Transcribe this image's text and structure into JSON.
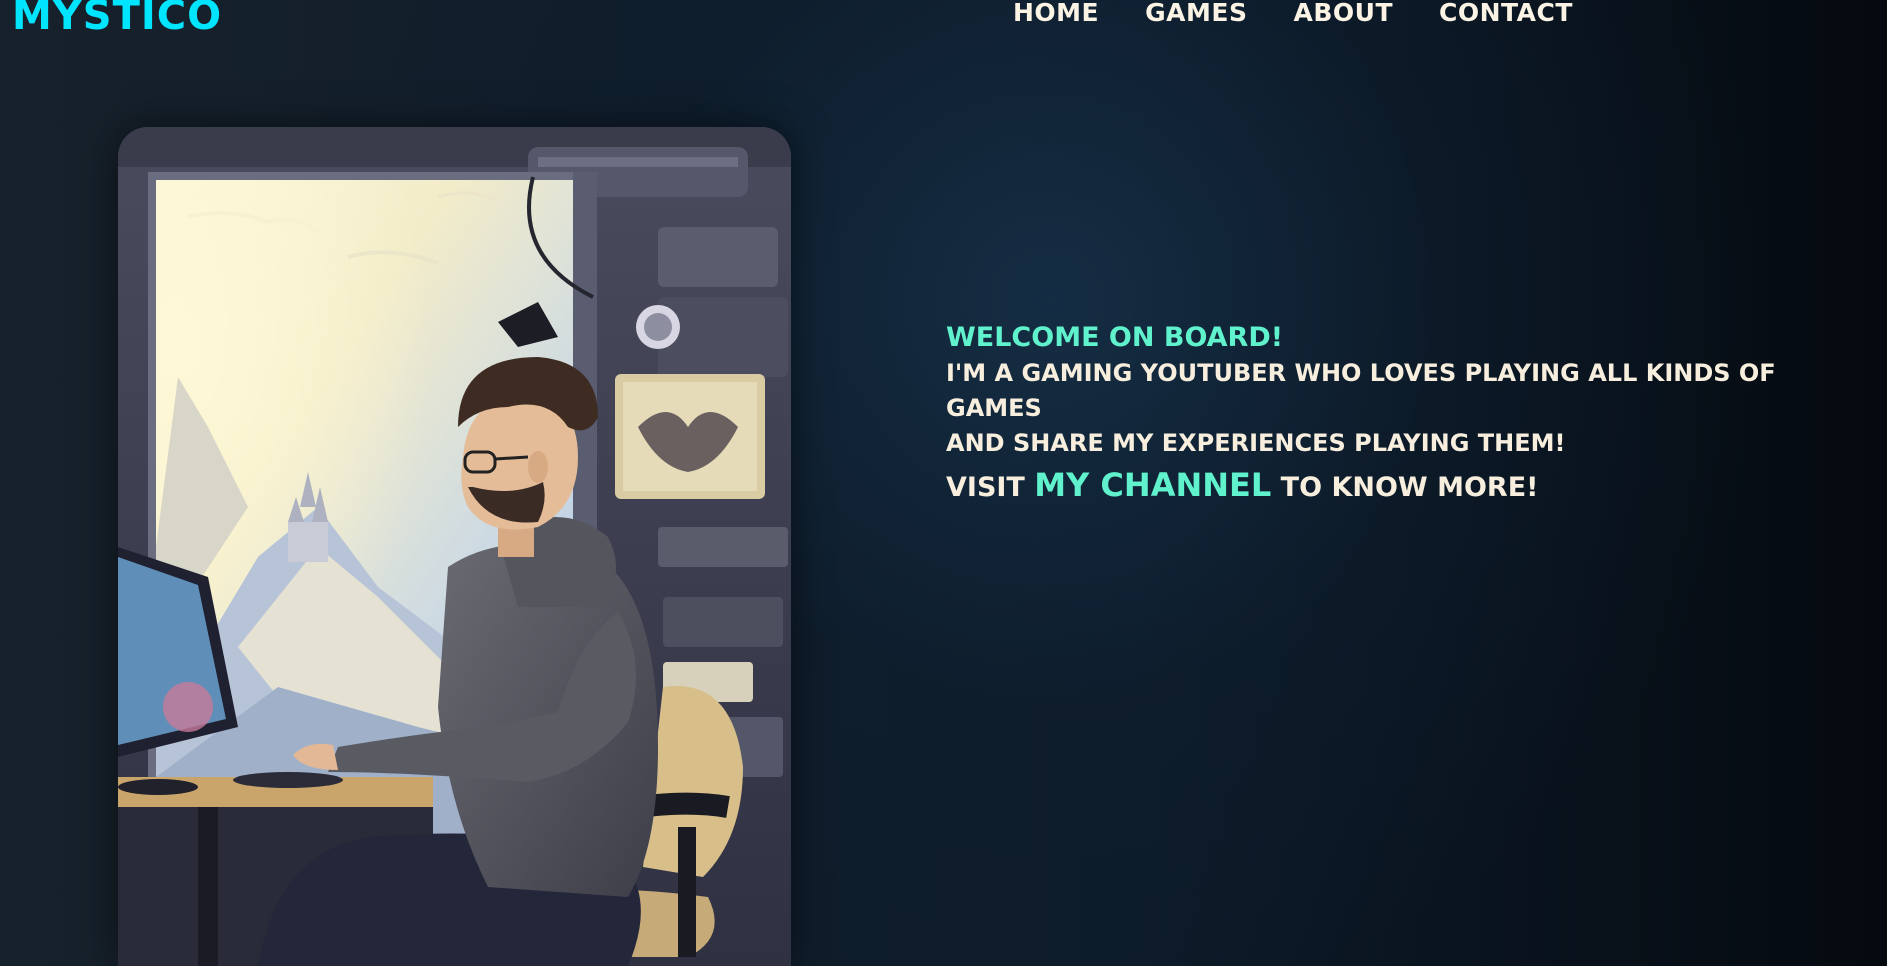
{
  "header": {
    "logo": "MYSTICO",
    "nav": [
      {
        "label": "HOME"
      },
      {
        "label": "GAMES"
      },
      {
        "label": "ABOUT"
      },
      {
        "label": "CONTACT"
      }
    ]
  },
  "hero": {
    "image_alt": "Illustration of a man with glasses and beard in a hoodie sitting at a desk using a computer, with a window showing snowy mountains and a castle",
    "welcome": "WELCOME ON BOARD!",
    "line1": "I'M A GAMING YOUTUBER WHO LOVES PLAYING ALL KINDS OF GAMES",
    "line2": "AND SHARE MY EXPERIENCES PLAYING THEM!",
    "visit_prefix": "VISIT",
    "channel_link": "MY CHANNEL",
    "visit_suffix": "TO KNOW MORE!"
  },
  "colors": {
    "accent_cyan": "#00e5ff",
    "accent_mint": "#5ff2cd",
    "text_cream": "#f7eedd",
    "background": "#0d1b2a"
  }
}
